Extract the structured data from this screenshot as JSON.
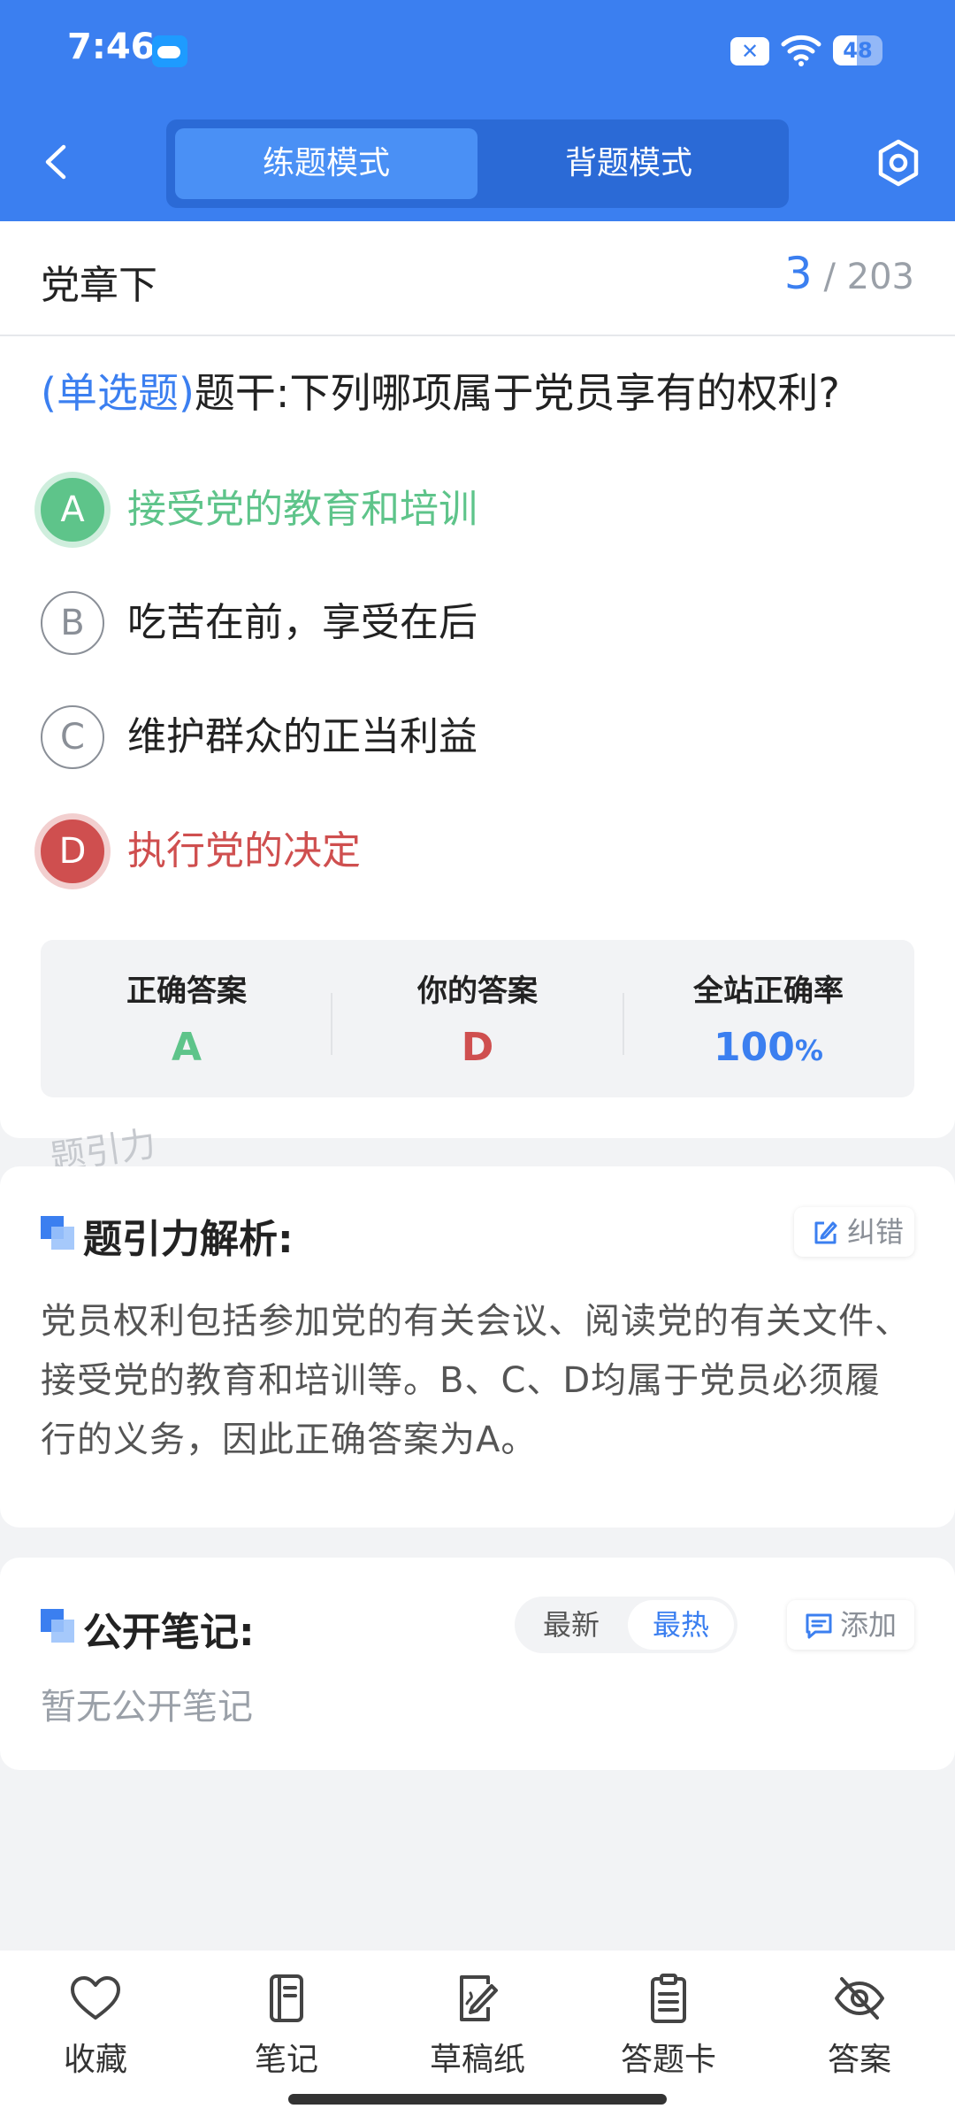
{
  "status_bar": {
    "time": "7:46",
    "battery": "48",
    "battery_level": 0.48
  },
  "header": {
    "modes": [
      {
        "label": "练题模式",
        "active": true
      },
      {
        "label": "背题模式",
        "active": false
      }
    ]
  },
  "question": {
    "chapter": "党章下",
    "current": "3",
    "total": "/ 203",
    "type": "(单选题)",
    "stem": "题干:下列哪项属于党员享有的权利?",
    "options": [
      {
        "letter": "A",
        "text": "接受党的教育和培训",
        "state": "correct"
      },
      {
        "letter": "B",
        "text": "吃苦在前，享受在后",
        "state": "normal"
      },
      {
        "letter": "C",
        "text": "维护群众的正当利益",
        "state": "normal"
      },
      {
        "letter": "D",
        "text": "执行党的决定",
        "state": "wrong"
      }
    ],
    "answer_summary": {
      "correct_label": "正确答案",
      "correct_value": "A",
      "yours_label": "你的答案",
      "yours_value": "D",
      "rate_label": "全站正确率",
      "rate_value": "100",
      "rate_unit": "%"
    },
    "watermark": "题引力"
  },
  "analysis": {
    "title": "题引力解析:",
    "report_button": "纠错",
    "text": "党员权利包括参加党的有关会议、阅读党的有关文件、接受党的教育和培训等。B、C、D均属于党员必须履行的义务，因此正确答案为A。"
  },
  "notes": {
    "title": "公开笔记:",
    "sort_latest": "最新",
    "sort_hot": "最热",
    "add_button": "添加",
    "empty": "暂无公开笔记"
  },
  "bottom_bar": {
    "items": [
      {
        "label": "收藏",
        "icon": "heart-icon"
      },
      {
        "label": "笔记",
        "icon": "notebook-icon"
      },
      {
        "label": "草稿纸",
        "icon": "draft-icon"
      },
      {
        "label": "答题卡",
        "icon": "answer-card-icon"
      },
      {
        "label": "答案",
        "icon": "eye-off-icon"
      }
    ]
  },
  "colors": {
    "primary": "#3b7ff0",
    "correct": "#5ec48a",
    "wrong": "#cf4f4f"
  }
}
